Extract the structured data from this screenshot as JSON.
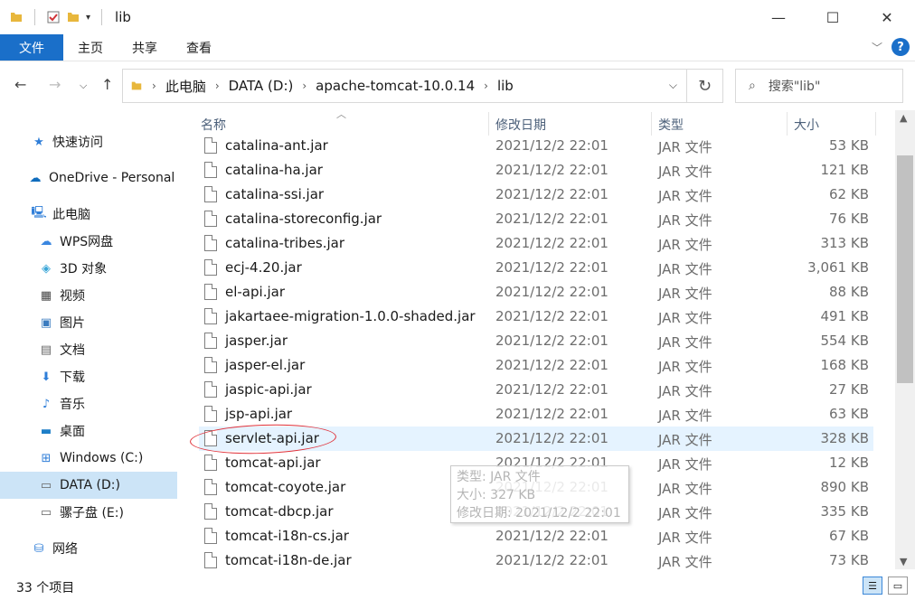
{
  "window": {
    "title": "lib"
  },
  "ribbon": {
    "tabs": [
      "文件",
      "主页",
      "共享",
      "查看"
    ]
  },
  "address": {
    "crumbs": [
      "此电脑",
      "DATA (D:)",
      "apache-tomcat-10.0.14",
      "lib"
    ],
    "search_placeholder": "搜索\"lib\""
  },
  "nav": {
    "items": [
      {
        "label": "快速访问",
        "icon": "star-icon"
      },
      {
        "label": "OneDrive - Personal",
        "icon": "cloud-icon"
      },
      {
        "label": "此电脑",
        "icon": "computer-icon"
      },
      {
        "label": "WPS网盘",
        "icon": "cloud-icon"
      },
      {
        "label": "3D 对象",
        "icon": "cube-icon"
      },
      {
        "label": "视频",
        "icon": "video-icon"
      },
      {
        "label": "图片",
        "icon": "picture-icon"
      },
      {
        "label": "文档",
        "icon": "document-icon"
      },
      {
        "label": "下载",
        "icon": "download-icon"
      },
      {
        "label": "音乐",
        "icon": "music-icon"
      },
      {
        "label": "桌面",
        "icon": "desktop-icon"
      },
      {
        "label": "Windows (C:)",
        "icon": "drive-icon"
      },
      {
        "label": "DATA (D:)",
        "icon": "drive-icon"
      },
      {
        "label": "骡子盘 (E:)",
        "icon": "drive-icon"
      },
      {
        "label": "网络",
        "icon": "network-icon"
      }
    ],
    "selected": "DATA (D:)"
  },
  "columns": {
    "name": "名称",
    "modified": "修改日期",
    "type": "类型",
    "size": "大小"
  },
  "files": [
    {
      "name": "catalina-ant.jar",
      "modified": "2021/12/2 22:01",
      "type": "JAR 文件",
      "size": "53 KB"
    },
    {
      "name": "catalina-ha.jar",
      "modified": "2021/12/2 22:01",
      "type": "JAR 文件",
      "size": "121 KB"
    },
    {
      "name": "catalina-ssi.jar",
      "modified": "2021/12/2 22:01",
      "type": "JAR 文件",
      "size": "62 KB"
    },
    {
      "name": "catalina-storeconfig.jar",
      "modified": "2021/12/2 22:01",
      "type": "JAR 文件",
      "size": "76 KB"
    },
    {
      "name": "catalina-tribes.jar",
      "modified": "2021/12/2 22:01",
      "type": "JAR 文件",
      "size": "313 KB"
    },
    {
      "name": "ecj-4.20.jar",
      "modified": "2021/12/2 22:01",
      "type": "JAR 文件",
      "size": "3,061 KB"
    },
    {
      "name": "el-api.jar",
      "modified": "2021/12/2 22:01",
      "type": "JAR 文件",
      "size": "88 KB"
    },
    {
      "name": "jakartaee-migration-1.0.0-shaded.jar",
      "modified": "2021/12/2 22:01",
      "type": "JAR 文件",
      "size": "491 KB"
    },
    {
      "name": "jasper.jar",
      "modified": "2021/12/2 22:01",
      "type": "JAR 文件",
      "size": "554 KB"
    },
    {
      "name": "jasper-el.jar",
      "modified": "2021/12/2 22:01",
      "type": "JAR 文件",
      "size": "168 KB"
    },
    {
      "name": "jaspic-api.jar",
      "modified": "2021/12/2 22:01",
      "type": "JAR 文件",
      "size": "27 KB"
    },
    {
      "name": "jsp-api.jar",
      "modified": "2021/12/2 22:01",
      "type": "JAR 文件",
      "size": "63 KB"
    },
    {
      "name": "servlet-api.jar",
      "modified": "2021/12/2 22:01",
      "type": "JAR 文件",
      "size": "328 KB"
    },
    {
      "name": "tomcat-api.jar",
      "modified": "2021/12/2 22:01",
      "type": "JAR 文件",
      "size": "12 KB"
    },
    {
      "name": "tomcat-coyote.jar",
      "modified": "2021/12/2 22:01",
      "type": "JAR 文件",
      "size": "890 KB"
    },
    {
      "name": "tomcat-dbcp.jar",
      "modified": "2021/12/2 22:01",
      "type": "JAR 文件",
      "size": "335 KB"
    },
    {
      "name": "tomcat-i18n-cs.jar",
      "modified": "2021/12/2 22:01",
      "type": "JAR 文件",
      "size": "67 KB"
    },
    {
      "name": "tomcat-i18n-de.jar",
      "modified": "2021/12/2 22:01",
      "type": "JAR 文件",
      "size": "73 KB"
    }
  ],
  "hovered_file": "servlet-api.jar",
  "tooltip": {
    "type": "类型: JAR 文件",
    "size": "大小: 327 KB",
    "modified": "修改日期: 2021/12/2 22:01"
  },
  "status": {
    "count": "33 个项目"
  }
}
